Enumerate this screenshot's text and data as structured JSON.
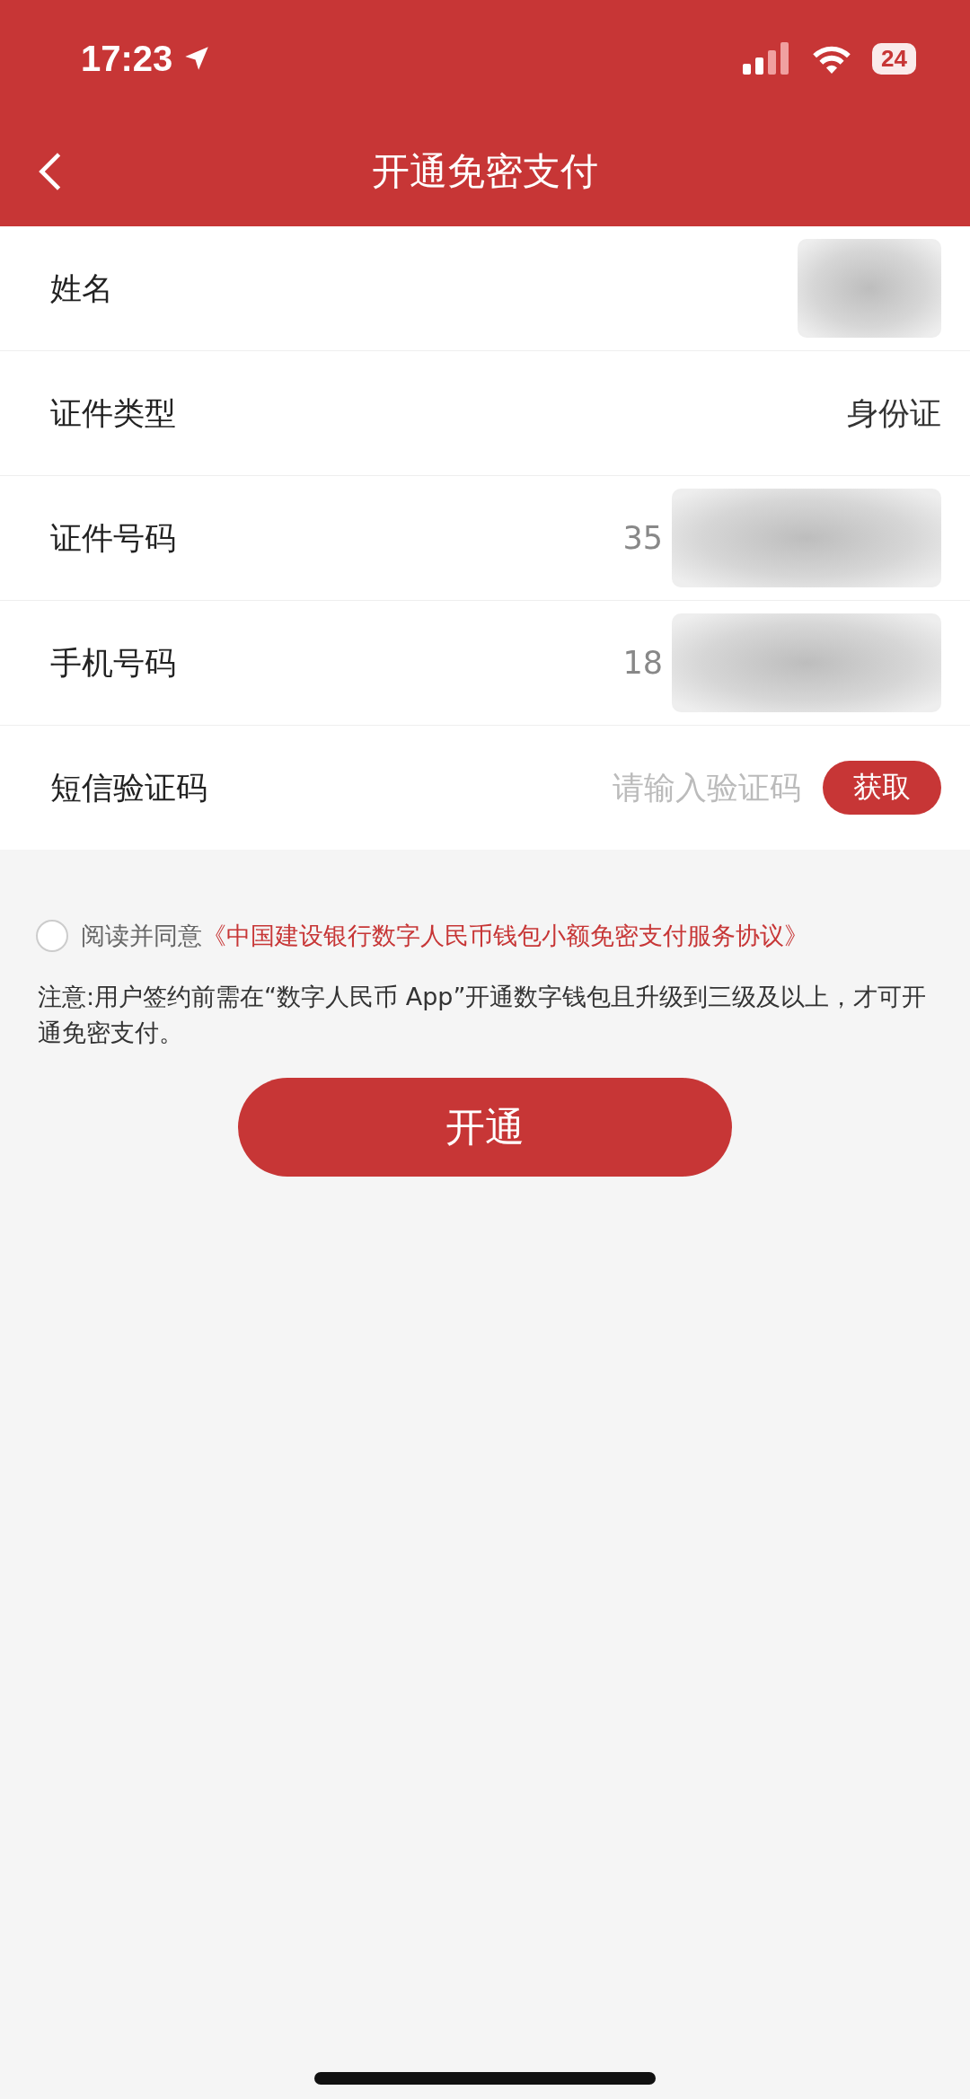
{
  "status_bar": {
    "time": "17:23",
    "battery": "24"
  },
  "nav": {
    "title": "开通免密支付"
  },
  "fields": [
    {
      "label": "姓名",
      "kind": "redacted"
    },
    {
      "label": "证件类型",
      "kind": "value",
      "value": "身份证"
    },
    {
      "label": "证件号码",
      "kind": "redacted",
      "value": "35"
    },
    {
      "label": "手机号码",
      "kind": "redacted",
      "value": "18"
    },
    {
      "label": "短信验证码",
      "kind": "code",
      "placeholder": "请输入验证码",
      "button": "获取"
    }
  ],
  "agreement": {
    "checked": false,
    "prefix": "阅读并同意",
    "link": "《中国建设银行数字人民币钱包小额免密支付服务协议》"
  },
  "note": "注意:用户签约前需在“数字人民币 App”开通数字钱包且升级到三级及以上，才可开通免密支付。",
  "submit": "开通"
}
